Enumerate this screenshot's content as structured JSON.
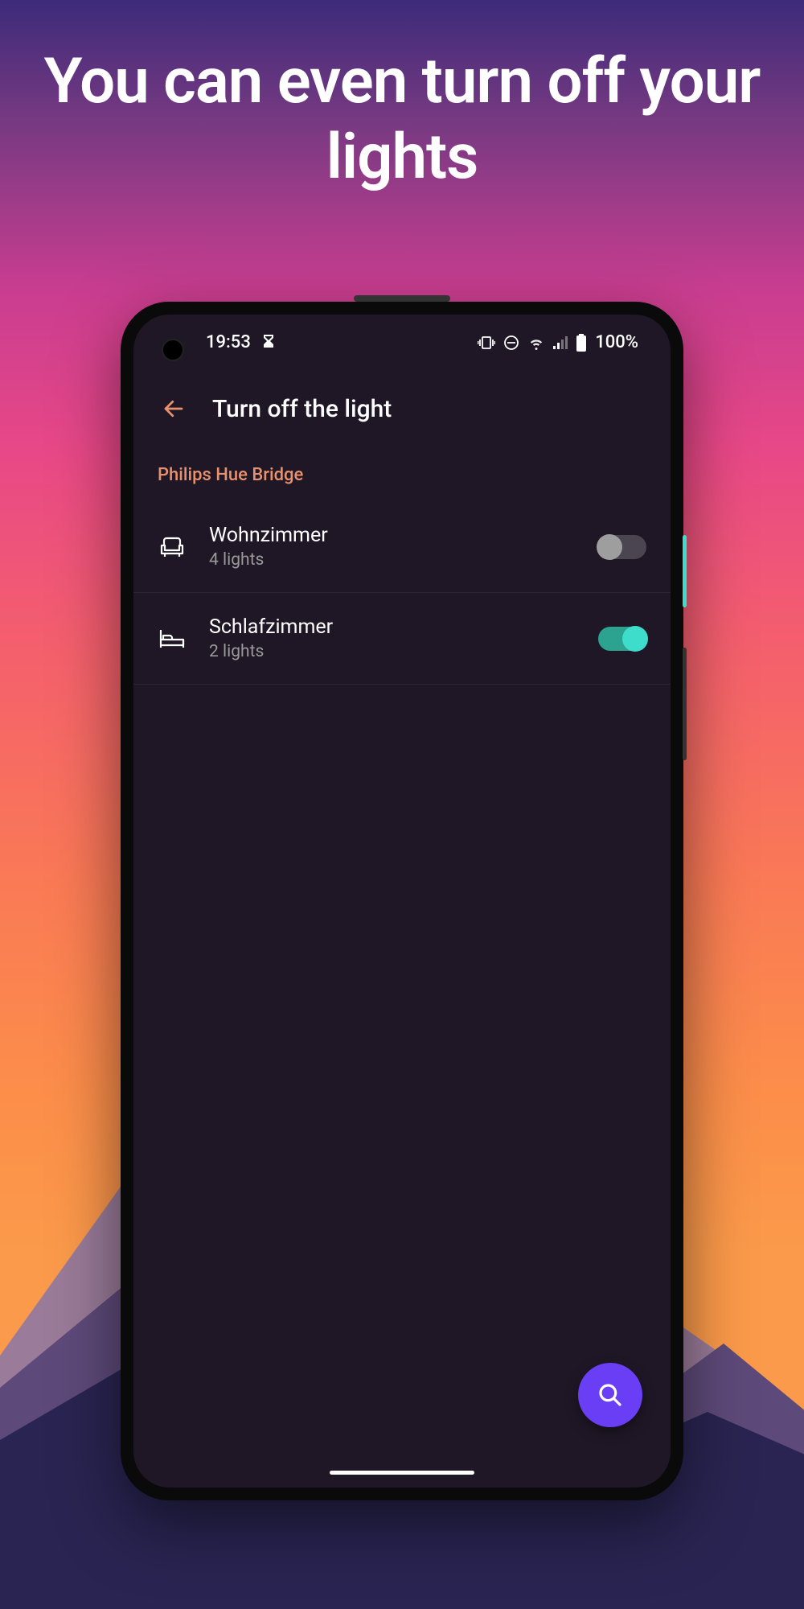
{
  "promo": {
    "headline": "You can even turn off your lights"
  },
  "statusBar": {
    "time": "19:53",
    "battery": "100%"
  },
  "appBar": {
    "title": "Turn off the light"
  },
  "section": {
    "header": "Philips Hue Bridge"
  },
  "rooms": [
    {
      "name": "Wohnzimmer",
      "subtitle": "4 lights",
      "icon": "sofa",
      "enabled": false
    },
    {
      "name": "Schlafzimmer",
      "subtitle": "2 lights",
      "icon": "bed",
      "enabled": true
    }
  ],
  "colors": {
    "accent": "#e8926d",
    "fab": "#6a3ef5",
    "toggleOn": "#3edcca"
  }
}
